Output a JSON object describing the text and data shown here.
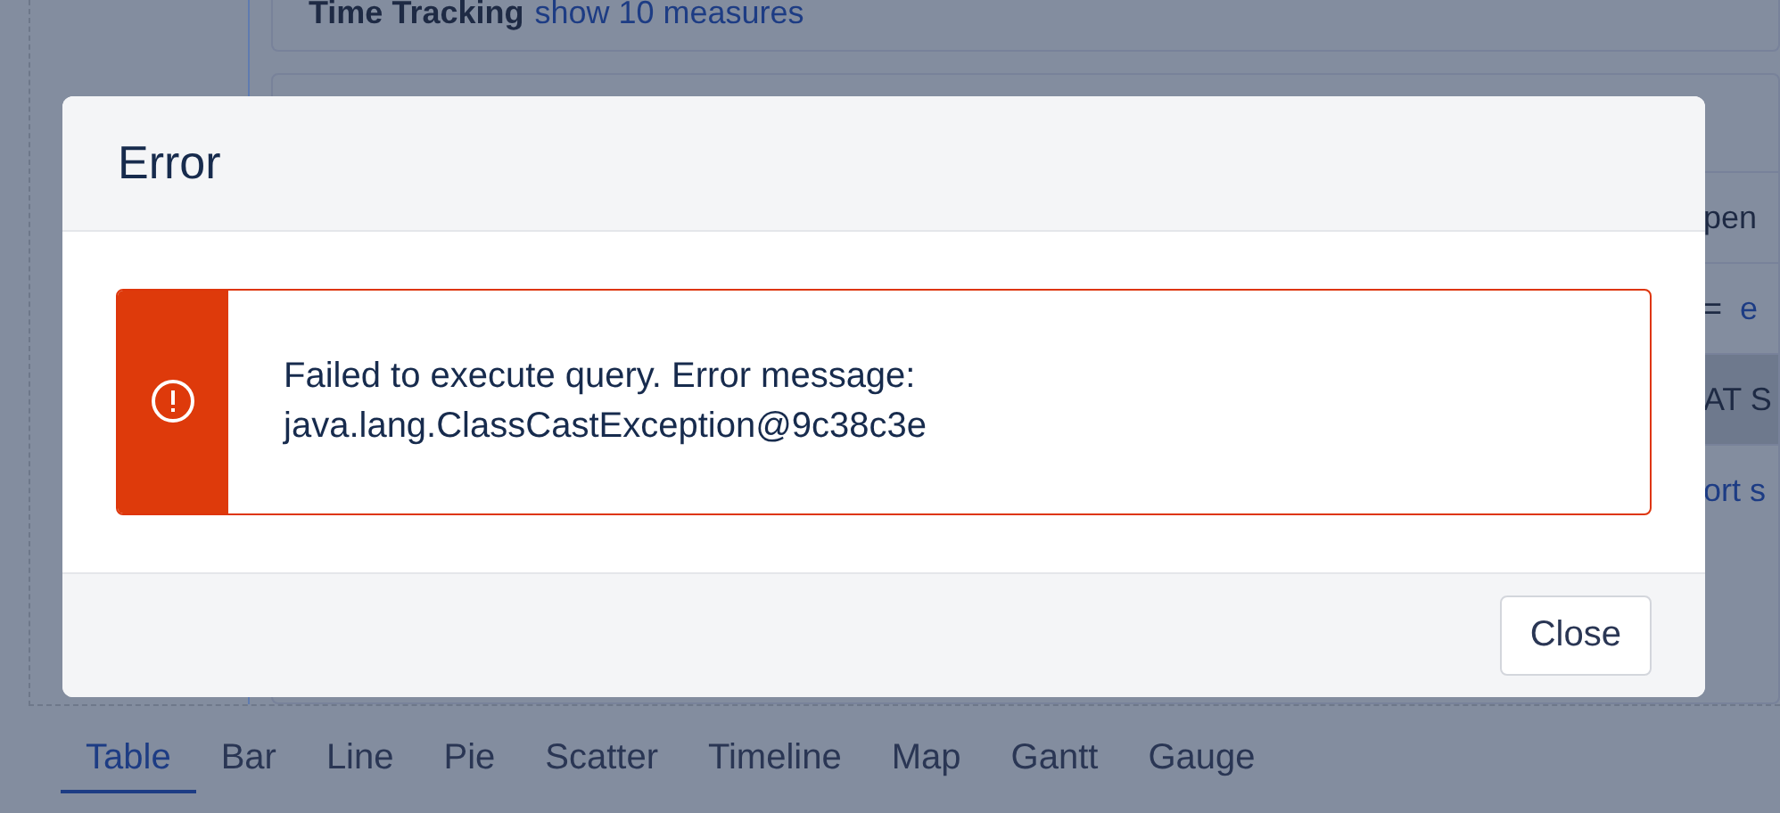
{
  "background": {
    "section": {
      "title": "Time Tracking",
      "link": "show 10 measures"
    },
    "side_rows": [
      {
        "selected": false,
        "parts": [
          {
            "kind": "text",
            "text": "pen"
          }
        ]
      },
      {
        "selected": false,
        "parts": [
          {
            "kind": "text",
            "text": "="
          },
          {
            "kind": "link",
            "text": "e"
          }
        ]
      },
      {
        "selected": true,
        "parts": [
          {
            "kind": "text",
            "text": "AT S"
          }
        ]
      },
      {
        "selected": false,
        "parts": [
          {
            "kind": "link",
            "text": "ort s"
          }
        ]
      }
    ],
    "tabs": [
      {
        "label": "Table",
        "selected": true
      },
      {
        "label": "Bar",
        "selected": false
      },
      {
        "label": "Line",
        "selected": false
      },
      {
        "label": "Pie",
        "selected": false
      },
      {
        "label": "Scatter",
        "selected": false
      },
      {
        "label": "Timeline",
        "selected": false
      },
      {
        "label": "Map",
        "selected": false
      },
      {
        "label": "Gantt",
        "selected": false
      },
      {
        "label": "Gauge",
        "selected": false
      }
    ]
  },
  "dialog": {
    "title": "Error",
    "message_lines": [
      "Failed to execute query. Error message:",
      "java.lang.ClassCastException@9c38c3e"
    ],
    "buttons": [
      "Close"
    ]
  }
}
